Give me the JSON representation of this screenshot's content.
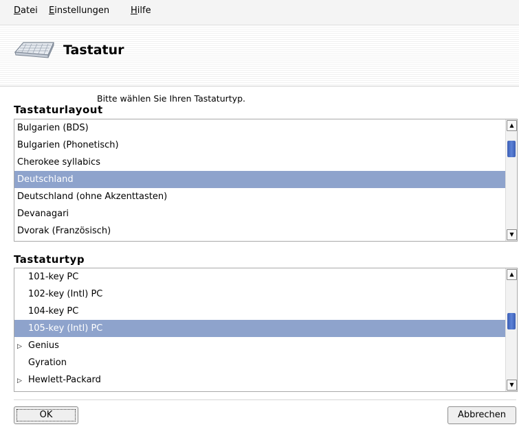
{
  "menu": {
    "items": [
      {
        "mnemonic": "D",
        "rest": "atei"
      },
      {
        "mnemonic": "E",
        "rest": "instellungen"
      },
      {
        "mnemonic": "H",
        "rest": "ilfe"
      }
    ]
  },
  "header": {
    "title": "Tastatur",
    "icon": "keyboard-icon"
  },
  "instruction": "Bitte wählen Sie Ihren Tastaturtyp.",
  "layout_section": {
    "title": "Tastaturlayout",
    "items": [
      "Bulgarien (BDS)",
      "Bulgarien (Phonetisch)",
      "Cherokee syllabics",
      "Deutschland",
      "Deutschland (ohne Akzenttasten)",
      "Devanagari",
      "Dvorak (Französisch)"
    ],
    "selected_index": 3
  },
  "type_section": {
    "title": "Tastaturtyp",
    "items": [
      "101-key PC",
      "102-key (Intl) PC",
      "104-key PC",
      "105-key (Intl) PC",
      "Genius",
      "Gyration",
      "Hewlett-Packard"
    ],
    "selected_index": 3
  },
  "buttons": {
    "ok": "OK",
    "cancel": "Abbrechen"
  },
  "colors": {
    "selection": "#8ea3cc",
    "scroll_thumb": "#4a6fc7"
  }
}
